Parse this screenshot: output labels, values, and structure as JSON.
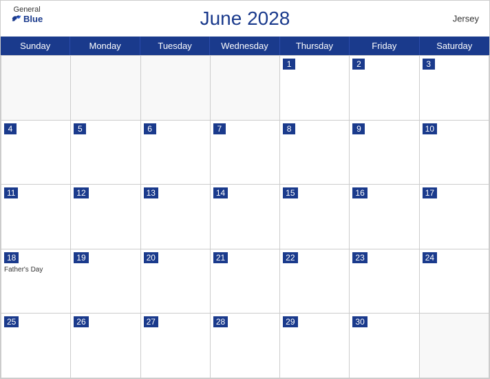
{
  "header": {
    "logo_general": "General",
    "logo_blue": "Blue",
    "title": "June 2028",
    "region": "Jersey"
  },
  "days_of_week": [
    "Sunday",
    "Monday",
    "Tuesday",
    "Wednesday",
    "Thursday",
    "Friday",
    "Saturday"
  ],
  "weeks": [
    [
      {
        "date": "",
        "empty": true
      },
      {
        "date": "",
        "empty": true
      },
      {
        "date": "",
        "empty": true
      },
      {
        "date": "",
        "empty": true
      },
      {
        "date": "1",
        "events": []
      },
      {
        "date": "2",
        "events": []
      },
      {
        "date": "3",
        "events": []
      }
    ],
    [
      {
        "date": "4",
        "events": []
      },
      {
        "date": "5",
        "events": []
      },
      {
        "date": "6",
        "events": []
      },
      {
        "date": "7",
        "events": []
      },
      {
        "date": "8",
        "events": []
      },
      {
        "date": "9",
        "events": []
      },
      {
        "date": "10",
        "events": []
      }
    ],
    [
      {
        "date": "11",
        "events": []
      },
      {
        "date": "12",
        "events": []
      },
      {
        "date": "13",
        "events": []
      },
      {
        "date": "14",
        "events": []
      },
      {
        "date": "15",
        "events": []
      },
      {
        "date": "16",
        "events": []
      },
      {
        "date": "17",
        "events": []
      }
    ],
    [
      {
        "date": "18",
        "events": [
          "Father's Day"
        ]
      },
      {
        "date": "19",
        "events": []
      },
      {
        "date": "20",
        "events": []
      },
      {
        "date": "21",
        "events": []
      },
      {
        "date": "22",
        "events": []
      },
      {
        "date": "23",
        "events": []
      },
      {
        "date": "24",
        "events": []
      }
    ],
    [
      {
        "date": "25",
        "events": []
      },
      {
        "date": "26",
        "events": []
      },
      {
        "date": "27",
        "events": []
      },
      {
        "date": "28",
        "events": []
      },
      {
        "date": "29",
        "events": []
      },
      {
        "date": "30",
        "events": []
      },
      {
        "date": "",
        "empty": true
      }
    ]
  ]
}
